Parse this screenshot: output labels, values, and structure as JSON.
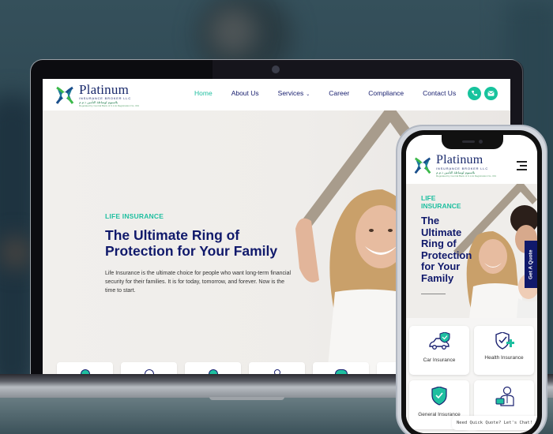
{
  "site": {
    "brand": {
      "name": "Platinum",
      "subtitle": "INSURANCE BROKER LLC",
      "arabic": "بلاتينيوم لوساطة التأمين ذ.م.م",
      "registration": "Regulated by Central Bank of U.A.E Registration No. 331"
    },
    "nav": [
      {
        "label": "Home",
        "active": true
      },
      {
        "label": "About Us",
        "active": false
      },
      {
        "label": "Services",
        "active": false,
        "has_dropdown": true
      },
      {
        "label": "Career",
        "active": false
      },
      {
        "label": "Compliance",
        "active": false
      },
      {
        "label": "Contact Us",
        "active": false
      }
    ],
    "contact_icons": [
      "phone-icon",
      "mail-icon"
    ],
    "hero": {
      "kicker": "LIFE INSURANCE",
      "title": "The Ultimate Ring of Protection for Your Family",
      "description": "Life Insurance is the ultimate choice for people who want long-term financial security for their families. It is for today, tomorrow, and forever. Now is the time to start."
    },
    "service_cards_count_visible": 6
  },
  "mobile": {
    "hero": {
      "kicker": "LIFE INSURANCE",
      "title": "The Ultimate Ring of Protection for Your Family"
    },
    "get_quote": "Get A Quote",
    "services": [
      {
        "label": "Car Insurance",
        "icon": "car-shield-icon"
      },
      {
        "label": "Health Insurance",
        "icon": "health-shield-icon"
      },
      {
        "label": "General Insurance",
        "icon": "shield-check-icon"
      },
      {
        "label": "",
        "icon": "business-person-icon"
      }
    ],
    "chat_prompt": "Need Quick Quote? Let's Chat!"
  },
  "colors": {
    "accent": "#1fbfa0",
    "navy": "#10196b",
    "background": "#efedea"
  }
}
